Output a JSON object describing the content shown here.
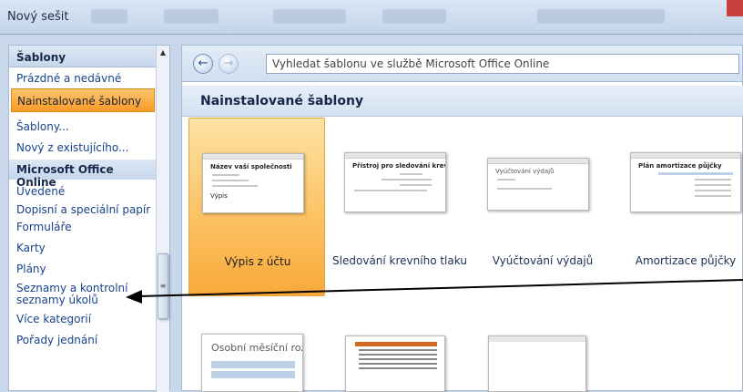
{
  "window": {
    "title": "Nový sešit"
  },
  "sidebar": {
    "header": "Šablony",
    "items": [
      {
        "label": "Prázdné a nedávné",
        "selected": false,
        "heading": false
      },
      {
        "label": "Nainstalované šablony",
        "selected": true,
        "heading": false
      },
      {
        "label": "Šablony...",
        "selected": false,
        "heading": false
      },
      {
        "label": "Nový z existujícího...",
        "selected": false,
        "heading": false
      },
      {
        "label": "Microsoft Office Online",
        "selected": false,
        "heading": true
      },
      {
        "label": "Uvedené",
        "selected": false,
        "heading": false
      },
      {
        "label": "Dopisní a speciální papír",
        "selected": false,
        "heading": false
      },
      {
        "label": "Formuláře",
        "selected": false,
        "heading": false
      },
      {
        "label": "Karty",
        "selected": false,
        "heading": false
      },
      {
        "label": "Plány",
        "selected": false,
        "heading": false
      },
      {
        "label": "Seznamy a kontrolní seznamy úkolů",
        "selected": false,
        "heading": false
      },
      {
        "label": "Více kategorií",
        "selected": false,
        "heading": false
      },
      {
        "label": "Pořady jednání",
        "selected": false,
        "heading": false
      }
    ]
  },
  "nav": {
    "back_icon": "back-arrow-icon",
    "forward_icon": "forward-arrow-icon",
    "search_text": "Vyhledat šablonu ve službě Microsoft Office Online"
  },
  "section": {
    "title": "Nainstalované šablony"
  },
  "templates": [
    {
      "label": "Výpis z účtu",
      "selected": true,
      "thumb_title": "Název vaší společnosti",
      "thumb_sub": "Výpis"
    },
    {
      "label": "Sledování krevního tlaku",
      "selected": false,
      "thumb_title": "Přístroj pro sledování krevního tl"
    },
    {
      "label": "Vyúčtování výdajů",
      "selected": false,
      "thumb_title": "Vyúčtování výdajů"
    },
    {
      "label": "Amortizace půjčky",
      "selected": false,
      "thumb_title": "Plán amortizace půjčky"
    }
  ],
  "templates_row2": [
    {
      "thumb_title": "Osobní měsíční rozpo"
    }
  ],
  "colors": {
    "accent": "#f89b27",
    "link": "#15428b",
    "arrow": "#000000"
  }
}
